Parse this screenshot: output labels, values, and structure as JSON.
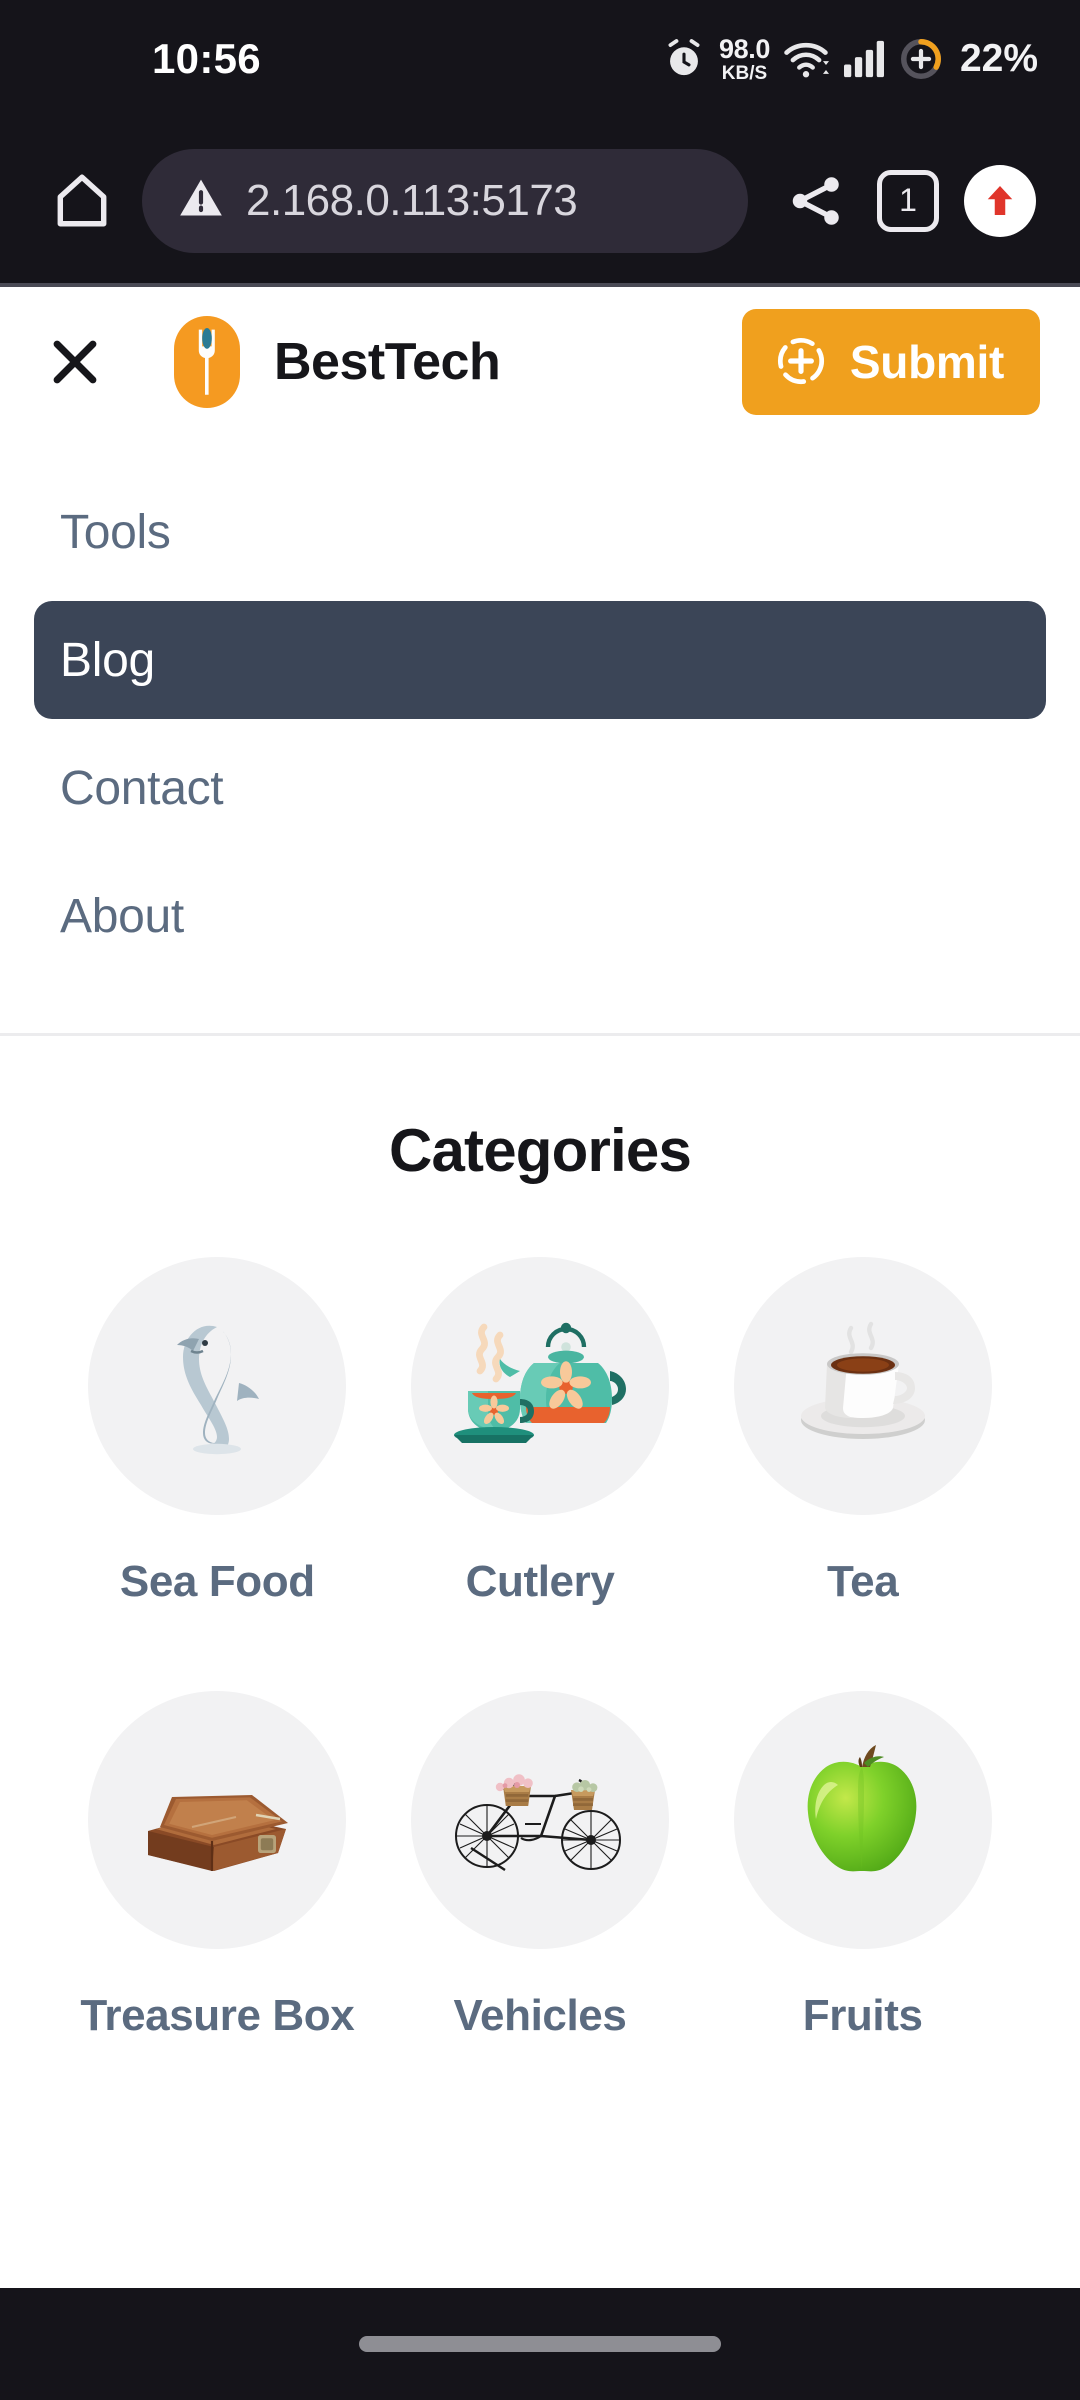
{
  "status_bar": {
    "clock": "10:56",
    "alarm_icon": "alarm-clock-icon",
    "net_speed_value": "98.0",
    "net_speed_unit": "KB/S",
    "wifi_icon": "wifi-icon",
    "signal_icon": "cellular-signal-icon",
    "battery_saver_icon": "battery-saver-icon",
    "battery_percent": "22%"
  },
  "browser": {
    "home_icon": "home-icon",
    "security_icon": "insecure-warning-icon",
    "url": "2.168.0.113:5173",
    "share_icon": "share-icon",
    "tab_count": "1",
    "upload_icon": "upload-arrow-icon"
  },
  "app_header": {
    "close_icon": "close-icon",
    "logo_icon": "besttech-logo-icon",
    "title": "BestTech",
    "submit_icon": "add-circle-dashed-icon",
    "submit_label": "Submit"
  },
  "nav": {
    "items": [
      {
        "label": "Tools",
        "active": false
      },
      {
        "label": "Blog",
        "active": true
      },
      {
        "label": "Contact",
        "active": false
      },
      {
        "label": "About",
        "active": false
      }
    ]
  },
  "categories": {
    "title": "Categories",
    "items": [
      {
        "label": "Sea Food",
        "icon": "dolphin-icon"
      },
      {
        "label": "Cutlery",
        "icon": "teapot-teacup-icon"
      },
      {
        "label": "Tea",
        "icon": "hot-beverage-cup-icon"
      },
      {
        "label": "Treasure Box",
        "icon": "wooden-box-icon"
      },
      {
        "label": "Vehicles",
        "icon": "bicycle-icon"
      },
      {
        "label": "Fruits",
        "icon": "green-apple-icon"
      }
    ]
  },
  "gesture_nav": {
    "home_indicator": "home-indicator-pill"
  },
  "colors": {
    "accent_orange": "#f0a01e",
    "nav_active_bg": "#3b4557",
    "nav_text": "#5b6b80",
    "chrome_bg": "#15141a",
    "url_pill_bg": "#2f2b38",
    "circle_bg": "#f2f2f3"
  }
}
